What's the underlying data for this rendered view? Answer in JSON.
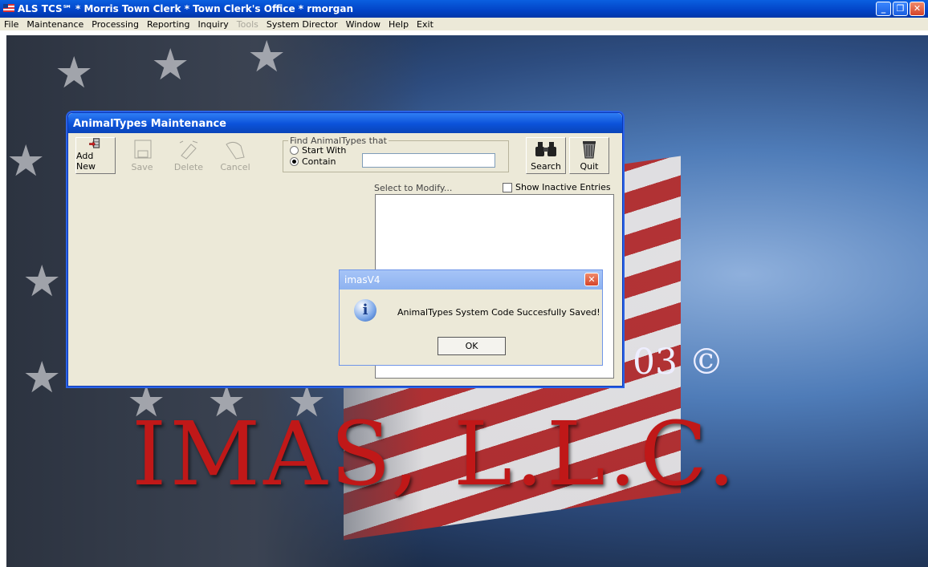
{
  "app": {
    "title": "ALS TCS℠ * Morris Town Clerk * Town Clerk's Office * rmorgan"
  },
  "menu": [
    "File",
    "Maintenance",
    "Processing",
    "Reporting",
    "Inquiry",
    "Tools",
    "System Director",
    "Window",
    "Help",
    "Exit"
  ],
  "desktop": {
    "big_text": "IMAS, L.L.C.",
    "copyright": "03 ©"
  },
  "maint": {
    "title": "AnimalTypes Maintenance",
    "buttons": {
      "add_new": "Add New",
      "save": "Save",
      "delete": "Delete",
      "cancel": "Cancel",
      "search": "Search",
      "quit": "Quit"
    },
    "find": {
      "legend": "Find AnimalTypes that",
      "start_with": "Start With",
      "contain": "Contain",
      "value": ""
    },
    "select_label": "Select to Modify...",
    "show_inactive": "Show Inactive Entries"
  },
  "dialog": {
    "title": "imasV4",
    "message": "AnimalTypes System Code Succesfully Saved!",
    "ok": "OK"
  }
}
